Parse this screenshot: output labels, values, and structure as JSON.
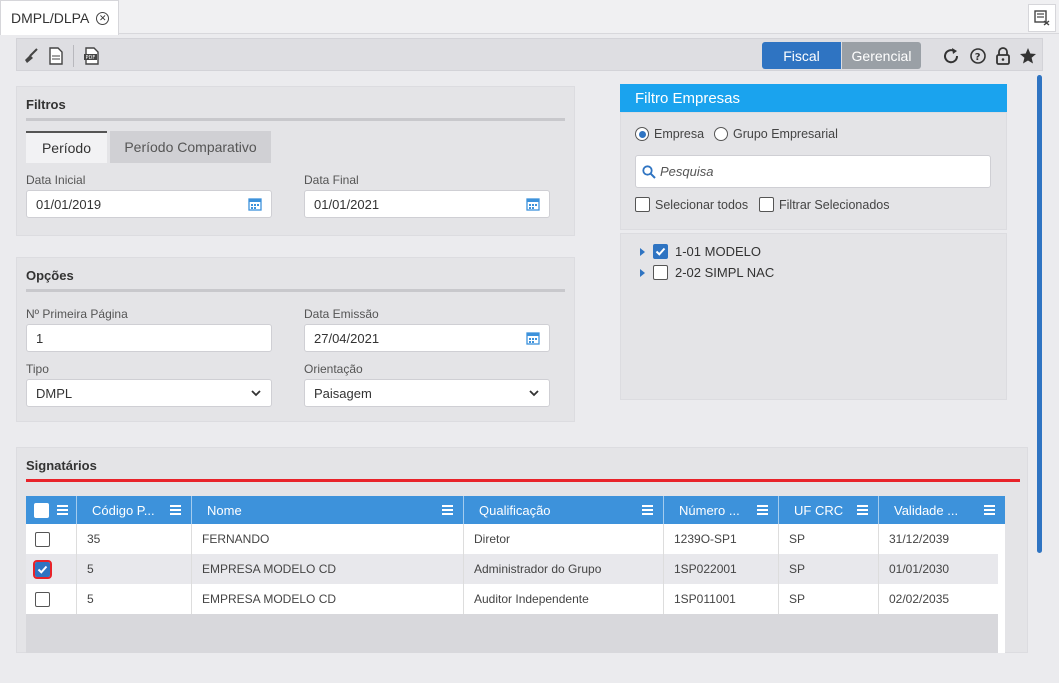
{
  "tab": {
    "label": "DMPL/DLPA"
  },
  "toolbar": {
    "fiscal": "Fiscal",
    "gerencial": "Gerencial"
  },
  "filtros": {
    "title": "Filtros",
    "tab_periodo": "Período",
    "tab_comparativo": "Período Comparativo",
    "data_inicial_label": "Data Inicial",
    "data_inicial": "01/01/2019",
    "data_final_label": "Data Final",
    "data_final": "01/01/2021"
  },
  "opcoes": {
    "title": "Opções",
    "primeira_pagina_label": "Nº Primeira Página",
    "primeira_pagina": "1",
    "data_emissao_label": "Data Emissão",
    "data_emissao": "27/04/2021",
    "tipo_label": "Tipo",
    "tipo": "DMPL",
    "orientacao_label": "Orientação",
    "orientacao": "Paisagem"
  },
  "filtro_empresas": {
    "title": "Filtro Empresas",
    "radio_empresa": "Empresa",
    "radio_grupo": "Grupo Empresarial",
    "search_placeholder": "Pesquisa",
    "selecionar_todos": "Selecionar todos",
    "filtrar_selecionados": "Filtrar Selecionados",
    "items": [
      {
        "label": "1-01 MODELO",
        "checked": true
      },
      {
        "label": "2-02 SIMPL NAC",
        "checked": false
      }
    ]
  },
  "signatarios": {
    "title": "Signatários",
    "columns": [
      "Código P...",
      "Nome",
      "Qualificação",
      "Número ...",
      "UF CRC",
      "Validade ..."
    ],
    "rows": [
      {
        "checked": false,
        "codigo": "35",
        "nome": "FERNANDO",
        "qualificacao": "Diretor",
        "numero": "1239O-SP1",
        "uf": "SP",
        "validade": "31/12/2039"
      },
      {
        "checked": true,
        "codigo": "5",
        "nome": "EMPRESA MODELO CD",
        "qualificacao": "Administrador do Grupo",
        "numero": "1SP022001",
        "uf": "SP",
        "validade": "01/01/2030"
      },
      {
        "checked": false,
        "codigo": "5",
        "nome": "EMPRESA MODELO CD",
        "qualificacao": "Auditor Independente",
        "numero": "1SP011001",
        "uf": "SP",
        "validade": "02/02/2035"
      }
    ]
  },
  "colors": {
    "accent": "#2f74c2",
    "header_blue": "#1aa3ee",
    "grid_header": "#3d92db",
    "underline_red": "#e8232a"
  }
}
